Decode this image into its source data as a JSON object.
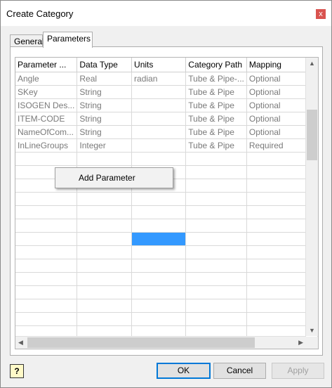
{
  "window": {
    "title": "Create Category",
    "close_glyph": "x"
  },
  "tabs": [
    {
      "label": "General"
    },
    {
      "label": "Parameters"
    }
  ],
  "grid": {
    "columns": [
      "Parameter ...",
      "Data Type",
      "Units",
      "Category Path",
      "Mapping"
    ],
    "rows": [
      [
        "Angle",
        "Real",
        "radian",
        "Tube & Pipe-...",
        "Optional"
      ],
      [
        "SKey",
        "String",
        "",
        "Tube & Pipe",
        "Optional"
      ],
      [
        "ISOGEN Des...",
        "String",
        "",
        "Tube & Pipe",
        "Optional"
      ],
      [
        "ITEM-CODE",
        "String",
        "",
        "Tube & Pipe",
        "Optional"
      ],
      [
        "NameOfCom...",
        "String",
        "",
        "Tube & Pipe",
        "Optional"
      ],
      [
        "InLineGroups",
        "Integer",
        "",
        "Tube & Pipe",
        "Required"
      ]
    ]
  },
  "context_menu": {
    "item": "Add Parameter"
  },
  "buttons": {
    "help": "?",
    "ok": "OK",
    "cancel": "Cancel",
    "apply": "Apply"
  }
}
